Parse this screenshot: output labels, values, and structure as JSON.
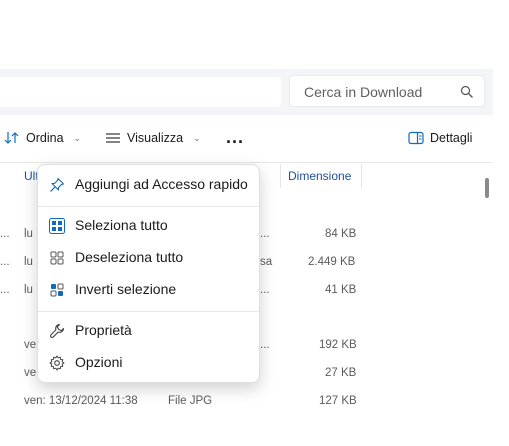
{
  "search": {
    "placeholder": "Cerca in Download"
  },
  "toolbar": {
    "sort_label": "Ordina",
    "view_label": "Visualizza",
    "more_label": "...",
    "details_label": "Dettagli"
  },
  "columns": {
    "modified_partial": "Ult",
    "size": "Dimensione"
  },
  "rows": [
    {
      "left": "...",
      "date": "lu",
      "type": "...",
      "size": "84 KB"
    },
    {
      "left": "...",
      "date": "lu",
      "type": "sa",
      "size": "2.449 KB"
    },
    {
      "left": "...",
      "date": "lu",
      "type": "...",
      "size": "41 KB"
    },
    {
      "left": "",
      "date": "ve",
      "type": "...",
      "size": "192 KB"
    },
    {
      "left": "",
      "date": "ve",
      "type": "",
      "size": "27 KB"
    },
    {
      "left": "",
      "date": "ven: 13/12/2024 11:38",
      "type": "File JPG",
      "size": "127 KB"
    }
  ],
  "context_menu": {
    "items": [
      {
        "label": "Aggiungi ad Accesso rapido",
        "icon": "pin-icon"
      },
      {
        "label": "Seleziona tutto",
        "icon": "select-all-icon"
      },
      {
        "label": "Deseleziona tutto",
        "icon": "select-none-icon"
      },
      {
        "label": "Inverti selezione",
        "icon": "invert-selection-icon"
      },
      {
        "label": "Proprietà",
        "icon": "wrench-icon"
      },
      {
        "label": "Opzioni",
        "icon": "gear-icon"
      }
    ]
  },
  "colors": {
    "accent": "#0f6cbd",
    "header_text": "#1f4f99",
    "menu_bg": "#ffffff",
    "bar_bg": "#f3f5f9"
  }
}
